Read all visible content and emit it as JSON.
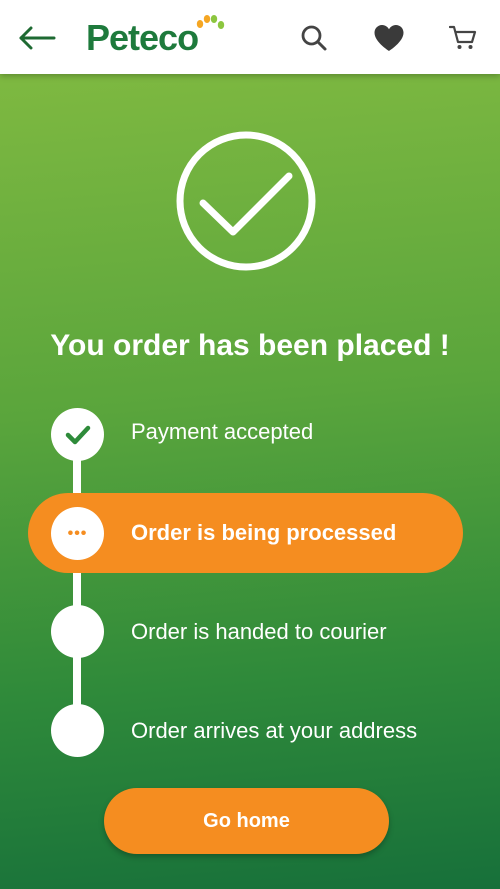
{
  "header": {
    "logo_text": "Peteco",
    "back_icon": "arrow-left-icon",
    "search_icon": "search-icon",
    "favorites_icon": "heart-icon",
    "cart_icon": "cart-icon"
  },
  "main": {
    "status_icon": "checkmark-circle-icon",
    "title": "You order has been placed !",
    "steps": [
      {
        "label": "Payment accepted",
        "state": "done"
      },
      {
        "label": "Order is being processed",
        "state": "active",
        "indicator": "•••"
      },
      {
        "label": "Order is handed to courier",
        "state": "pending"
      },
      {
        "label": "Order arrives at your address",
        "state": "pending"
      }
    ],
    "go_home_label": "Go home"
  },
  "colors": {
    "brand_green": "#1e7a3c",
    "accent_orange": "#f58d20",
    "paw_orange": "#f5a623",
    "paw_green": "#8cc63f",
    "background_top": "#86bd42",
    "background_bottom": "#17703a"
  }
}
